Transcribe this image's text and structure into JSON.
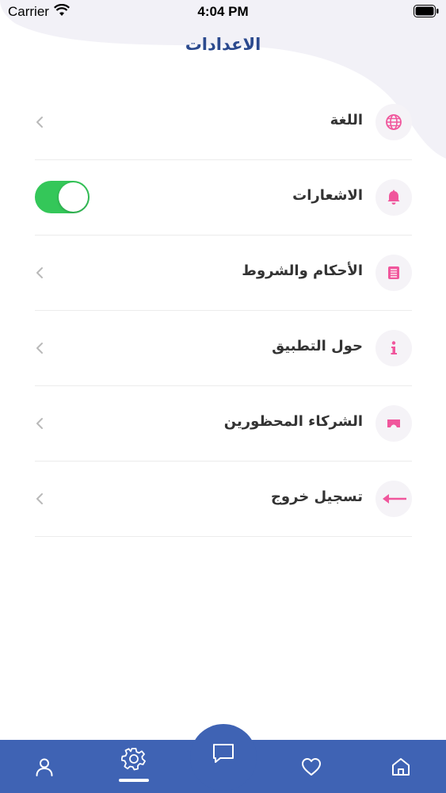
{
  "status_bar": {
    "carrier": "Carrier",
    "time": "4:04 PM",
    "wifi_icon": "wifi-icon",
    "battery_icon": "battery-icon"
  },
  "header": {
    "title": "الاعدادات"
  },
  "settings": {
    "items": [
      {
        "label": "اللغة",
        "icon": "globe-icon",
        "control": "chevron"
      },
      {
        "label": "الاشعارات",
        "icon": "bell-icon",
        "control": "toggle",
        "toggle_on": true
      },
      {
        "label": "الأحكام والشروط",
        "icon": "document-icon",
        "control": "chevron"
      },
      {
        "label": "حول التطبيق",
        "icon": "info-icon",
        "control": "chevron"
      },
      {
        "label": "الشركاء المحظورين",
        "icon": "blocked-partners-icon",
        "control": "chevron"
      },
      {
        "label": "تسجيل خروج",
        "icon": "logout-arrow-icon",
        "control": "chevron"
      }
    ]
  },
  "tab_bar": {
    "items": [
      "profile-icon",
      "settings-gear-icon",
      "chat-icon",
      "heart-icon",
      "home-icon"
    ],
    "active": "settings-gear-icon"
  },
  "colors": {
    "brand_blue": "#3f63b4",
    "title_blue": "#2c4a8e",
    "icon_pink": "#f0569c",
    "toggle_green": "#34c759",
    "icon_bg": "#f5f3f7"
  }
}
